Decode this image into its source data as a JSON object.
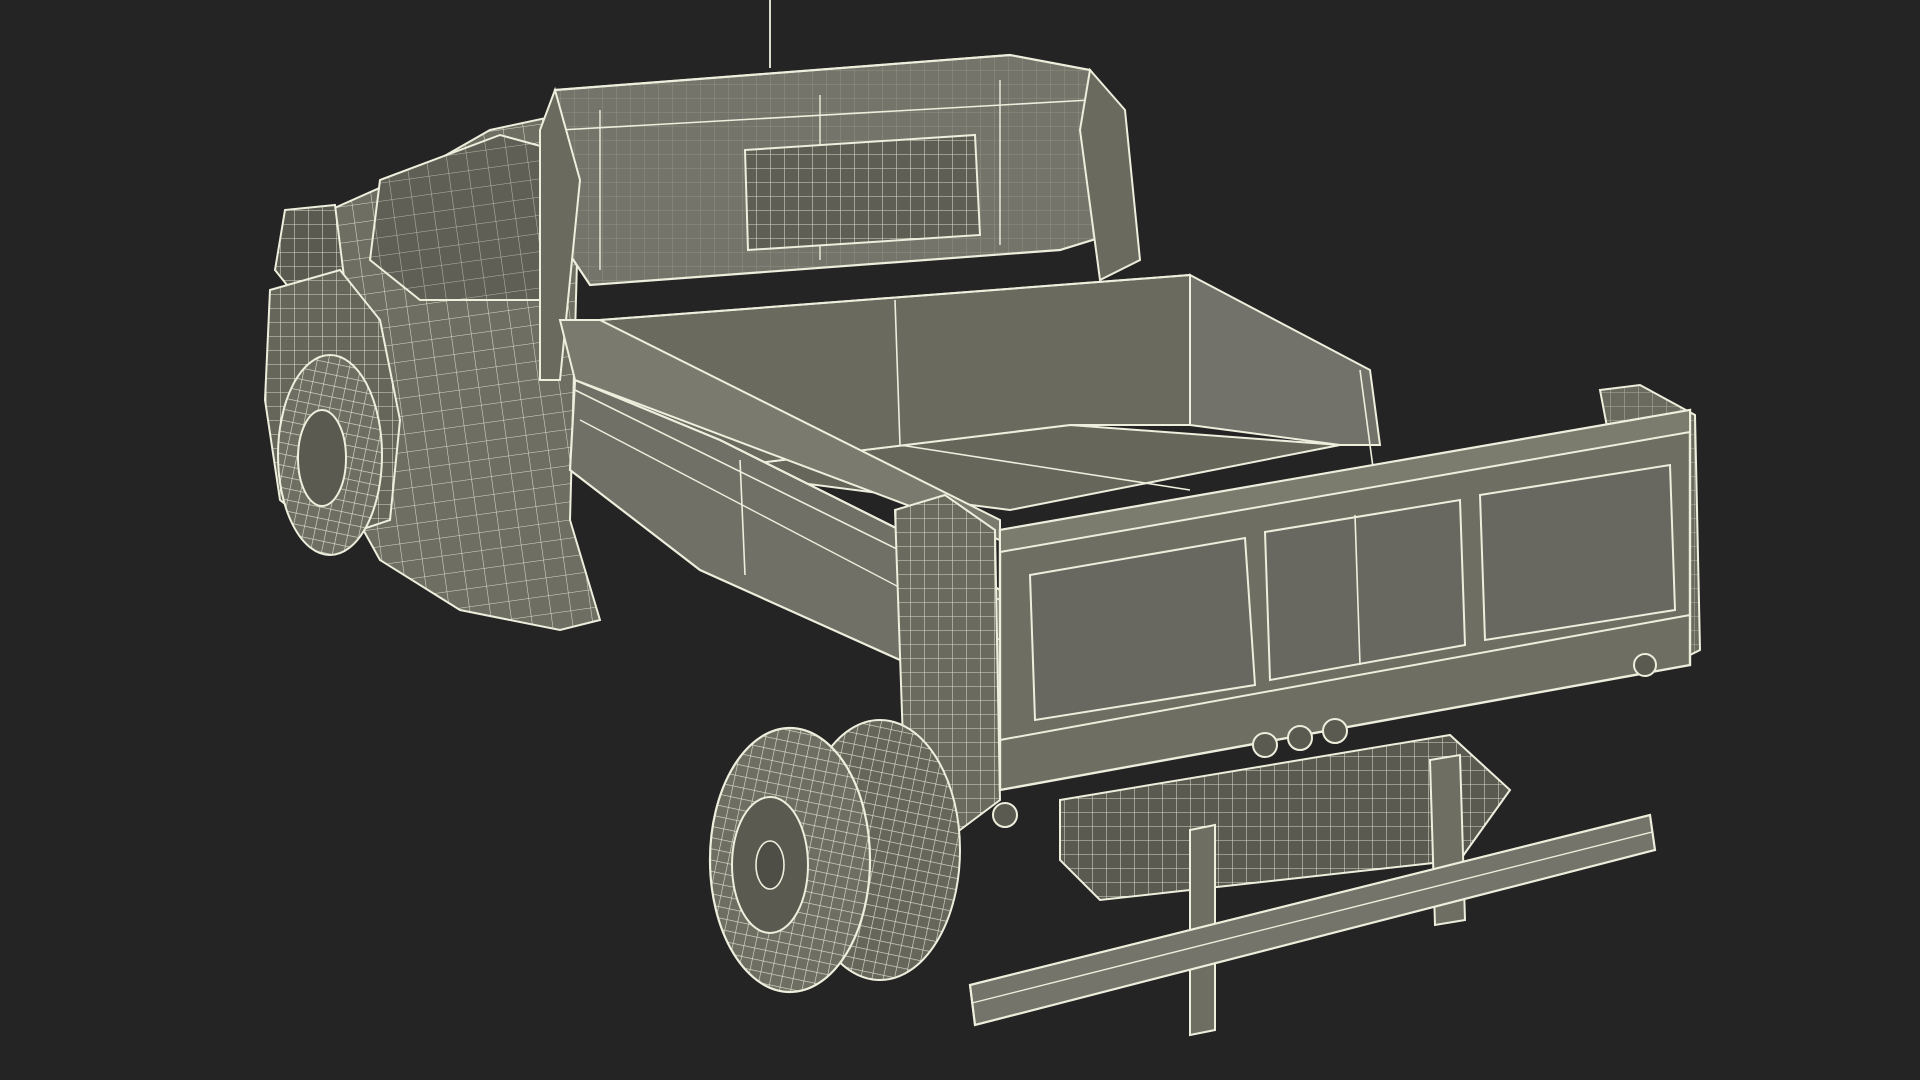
{
  "scene": {
    "background_color": "#242424",
    "mesh_fill": "#6e6e62",
    "mesh_fill_dark": "#5a5a50",
    "mesh_fill_light": "#7b7b6e",
    "wire_color": "#eeeedd",
    "subject": "wireframe-dump-truck-model"
  }
}
